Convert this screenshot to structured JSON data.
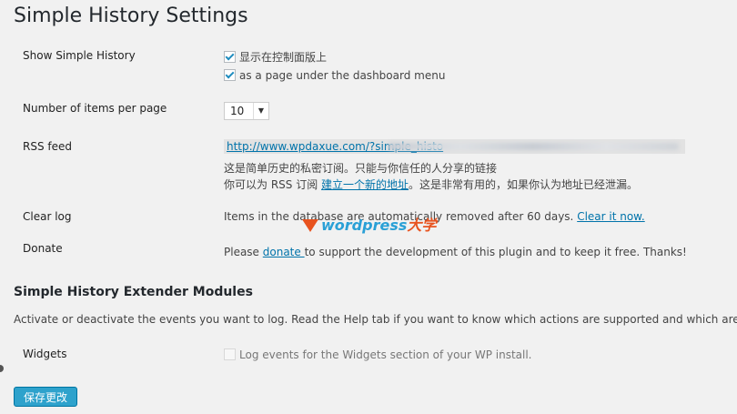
{
  "page": {
    "title": "Simple History Settings"
  },
  "settings": {
    "show": {
      "label": "Show Simple History",
      "options": [
        {
          "label": "显示在控制面版上",
          "checked": true
        },
        {
          "label": "as a page under the dashboard menu",
          "checked": true
        }
      ]
    },
    "items_per_page": {
      "label": "Number of items per page",
      "value": "10"
    },
    "rss": {
      "label": "RSS feed",
      "url": "http://www.wpdaxue.com/?simple_histo",
      "line1": "这是简单历史的私密订阅。只能与你信任的人分享的链接",
      "line2_prefix": "你可以为 RSS 订阅 ",
      "line2_link": "建立一个新的地址",
      "line2_suffix": "。这是非常有用的，如果你认为地址已经泄漏。"
    },
    "clear_log": {
      "label": "Clear log",
      "text": "Items in the database are automatically removed after 60 days. ",
      "link": "Clear it now."
    },
    "donate": {
      "label": "Donate",
      "prefix": "Please ",
      "link": "donate ",
      "suffix": "to support the development of this plugin and to keep it free. Thanks!"
    }
  },
  "extender": {
    "title": "Simple History Extender Modules",
    "description": "Activate or deactivate the events you want to log. Read the Help tab if you want to know which actions are supported and which aren't.",
    "widgets": {
      "label": "Widgets",
      "option": "Log events for the Widgets section of your WP install.",
      "checked": false
    }
  },
  "watermark": {
    "text": "wordpress",
    "cn": "大学"
  },
  "save_label": "保存更改"
}
